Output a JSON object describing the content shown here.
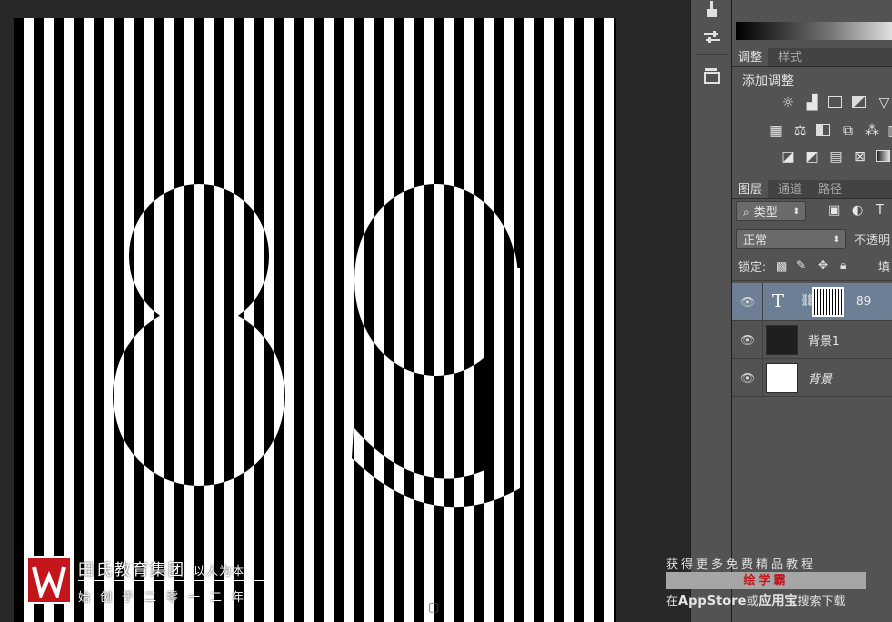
{
  "panels": {
    "adjustments": {
      "tabs": [
        "调整",
        "样式"
      ],
      "title": "添加调整"
    },
    "layers": {
      "tabs": [
        "图层",
        "通道",
        "路径"
      ],
      "filter_kind": "类型",
      "blend_mode": "正常",
      "opacity_label": "不透明",
      "lock_label": "锁定:",
      "fill_label": "填",
      "layers": [
        {
          "name": "89",
          "kind": "text",
          "selected": true,
          "visible": true
        },
        {
          "name": "背景1",
          "kind": "dark-fill",
          "selected": false,
          "visible": true
        },
        {
          "name": "背景",
          "kind": "white-fill",
          "selected": false,
          "visible": true
        }
      ]
    }
  },
  "watermark": {
    "org": "田氏教育集团",
    "org_sub": "以人为本",
    "tagline": "始创于二零一二年"
  },
  "promo": {
    "headline": "获得更多免费精品教程",
    "brand": "绘学霸",
    "store_prefix": "在",
    "store_app": "AppStore",
    "store_or": "或",
    "store_name": "应用宝",
    "store_suffix": "搜索下载"
  },
  "colors": {
    "selected_layer": "#6d7f95",
    "brand_red": "#c3151b",
    "panel_bg": "#535353"
  }
}
